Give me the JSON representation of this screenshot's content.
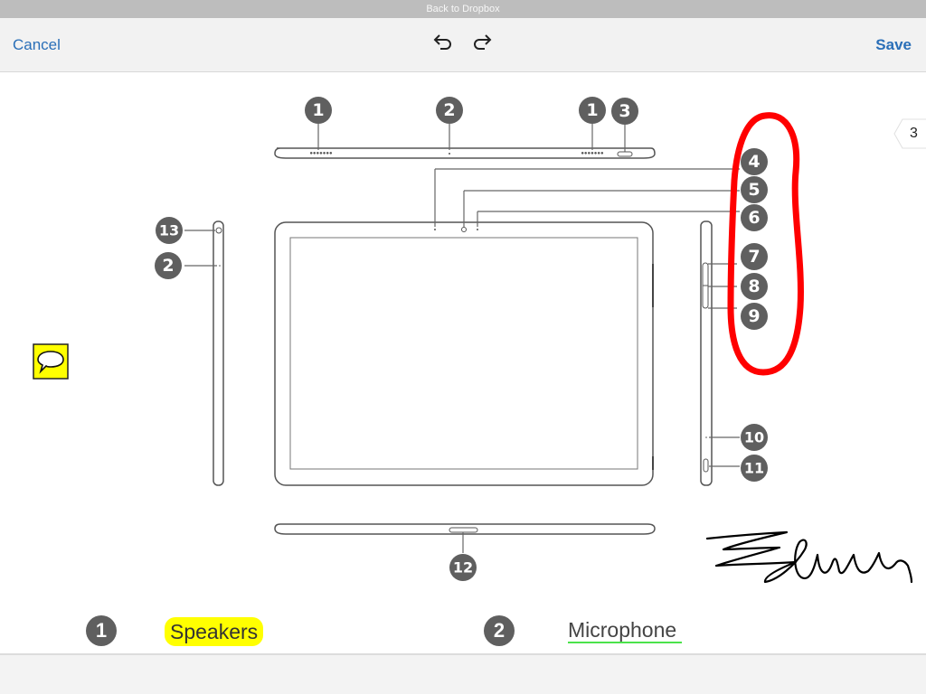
{
  "status_bar": {
    "text": "Back to Dropbox"
  },
  "toolbar": {
    "cancel_label": "Cancel",
    "save_label": "Save",
    "undo_icon": "undo-icon",
    "redo_icon": "redo-icon"
  },
  "page_indicator": {
    "value": "3"
  },
  "annotations": {
    "note_icon": "speech-bubble-icon",
    "note_color": "#ffff00",
    "circle_color": "#ff0000",
    "signature_text": "Edwin"
  },
  "diagram": {
    "callouts_top": [
      "1",
      "2",
      "1",
      "3"
    ],
    "callouts_right": [
      "4",
      "5",
      "6",
      "7",
      "8",
      "9",
      "10",
      "11"
    ],
    "callouts_left": [
      "13",
      "2"
    ],
    "callouts_bottom": [
      "12"
    ]
  },
  "legend": [
    {
      "number": "1",
      "label": "Speakers",
      "highlight": "#ffff00"
    },
    {
      "number": "2",
      "label": "Microphone",
      "underline": "#4be34b"
    }
  ]
}
